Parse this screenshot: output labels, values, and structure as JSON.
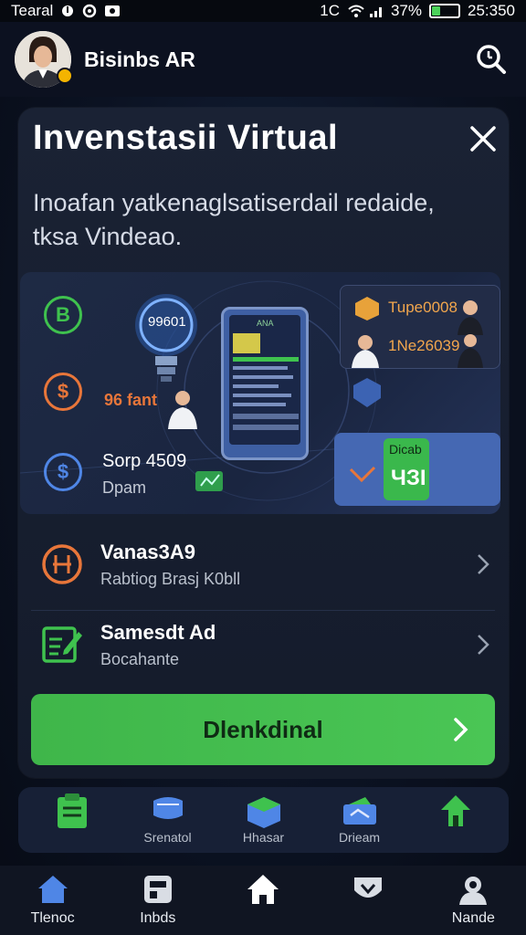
{
  "status_bar": {
    "carrier": "Tearal",
    "network": "1C",
    "battery": "37%",
    "battery_level": 0.37,
    "time": "25:350"
  },
  "header": {
    "app_name": "Bisinbs AR",
    "search_icon": "search-icon"
  },
  "card": {
    "title": "Invenstasii Virtual",
    "description": "Inoafan yatkenaglsatiserdail redaide, tksa Vindeao.",
    "close_icon": "close-icon",
    "illustration": {
      "bulb_value": "99601",
      "phone_header": "ANA",
      "promo_top": "Tupe0008",
      "promo_bottom": "1Ne26039",
      "left_coins": [
        {
          "symbol": "B",
          "color": "#3fc24e"
        },
        {
          "symbol": "$",
          "color": "#e8763a"
        },
        {
          "symbol": "$",
          "color": "#4f86e6"
        }
      ],
      "coin_caption": "96 fant",
      "stat_value": "Sorp 4509",
      "stat_label": "Dpam",
      "tile_top": "Dicab",
      "tile_bottom": "ЧЗI"
    },
    "list": [
      {
        "title": "Vanas3A9",
        "subtitle": "Rabtiog Brasj K0bll",
        "icon": "currency-coin-icon",
        "color": "#e8763a"
      },
      {
        "title": "Samesdt Ad",
        "subtitle": "Bocahante",
        "icon": "edit-document-icon",
        "color": "#3fc24e"
      }
    ],
    "cta": {
      "label": "Dlenkdinal"
    }
  },
  "quick_bar": [
    {
      "label": "",
      "icon": "clipboard-icon",
      "color": "#3fc24e"
    },
    {
      "label": "Srenatol",
      "icon": "chat-icon",
      "color": "#4f86e6"
    },
    {
      "label": "Hhasar",
      "icon": "box-icon",
      "color": "#3fc24e"
    },
    {
      "label": "Drieam",
      "icon": "wallet-icon",
      "color": "#4f86e6"
    },
    {
      "label": "",
      "icon": "home-arrow-icon",
      "color": "#3fc24e"
    }
  ],
  "bottom_nav": [
    {
      "label": "Tlenoc",
      "icon": "home-icon",
      "color": "#4f86e6"
    },
    {
      "label": "Inbds",
      "icon": "grid-icon",
      "color": "#d9dde4"
    },
    {
      "label": "",
      "icon": "house-icon",
      "color": "#ffffff"
    },
    {
      "label": "",
      "icon": "heart-shield-icon",
      "color": "#d9dde4"
    },
    {
      "label": "Nande",
      "icon": "profile-icon",
      "color": "#d9dde4"
    }
  ],
  "colors": {
    "accent_green": "#44bd50",
    "accent_blue": "#4f86e6",
    "accent_orange": "#e8763a"
  }
}
